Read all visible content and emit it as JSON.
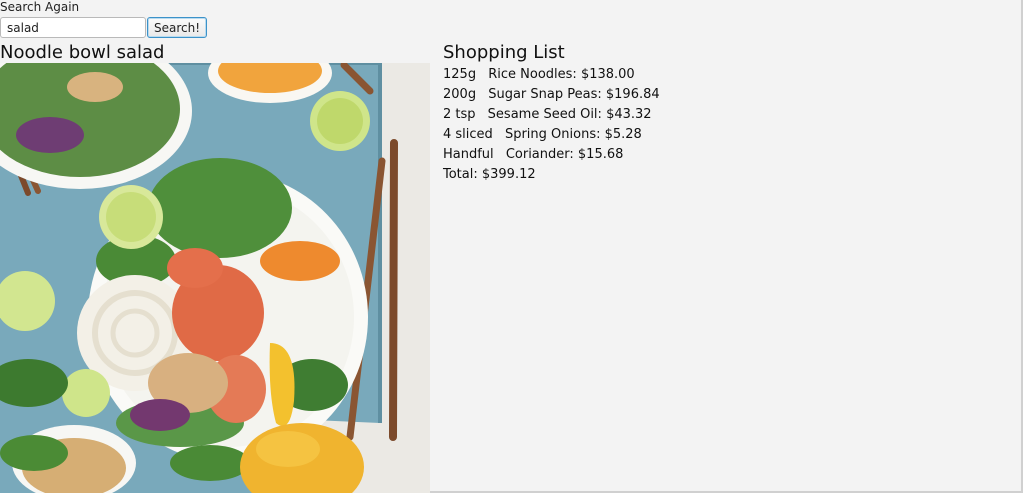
{
  "search": {
    "label": "Search Again",
    "value": "salad",
    "button_label": "Search!"
  },
  "recipe": {
    "title": "Noodle bowl salad",
    "image_icon": "recipe-photo"
  },
  "shopping_list": {
    "title": "Shopping List",
    "items": [
      {
        "quantity": "125g",
        "ingredient": "Rice Noodles:",
        "price": "$138.00"
      },
      {
        "quantity": "200g",
        "ingredient": "Sugar Snap Peas:",
        "price": "$196.84"
      },
      {
        "quantity": "2 tsp",
        "ingredient": "Sesame Seed Oil:",
        "price": "$43.32"
      },
      {
        "quantity": "4 sliced",
        "ingredient": "Spring Onions:",
        "price": "$5.28"
      },
      {
        "quantity": "Handful",
        "ingredient": "Coriander:",
        "price": "$15.68"
      }
    ],
    "total": "Total: $399.12"
  },
  "colors": {
    "background": "#f3f3f3",
    "button_border": "#3c92c9",
    "text": "#111111"
  }
}
